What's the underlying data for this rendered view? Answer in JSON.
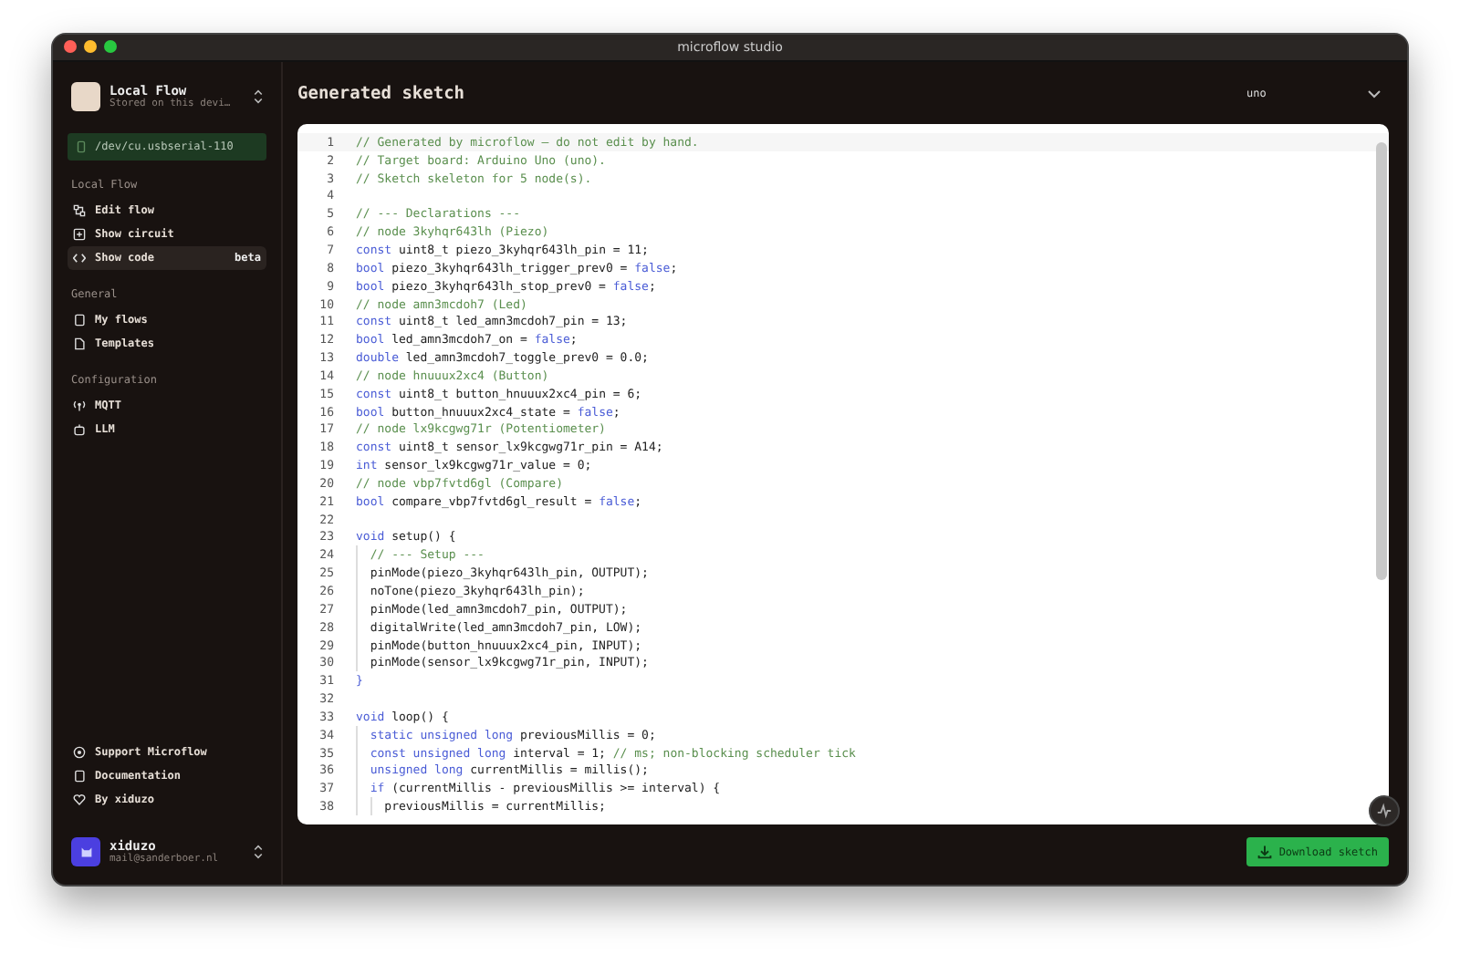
{
  "window": {
    "title": "microflow studio"
  },
  "project": {
    "name": "Local Flow",
    "subtitle": "Stored on this devi…"
  },
  "port": {
    "label": "/dev/cu.usbserial-110"
  },
  "sections": [
    {
      "title": "Local Flow",
      "items": [
        {
          "label": "Edit flow",
          "selected": false
        },
        {
          "label": "Show circuit",
          "selected": false
        },
        {
          "label": "Show code",
          "selected": true,
          "badge": "beta"
        }
      ]
    },
    {
      "title": "General",
      "items": [
        {
          "label": "My flows",
          "selected": false
        },
        {
          "label": "Templates",
          "selected": false
        }
      ]
    },
    {
      "title": "Configuration",
      "items": [
        {
          "label": "MQTT",
          "selected": false
        },
        {
          "label": "LLM",
          "selected": false
        }
      ]
    }
  ],
  "footer_links": [
    {
      "label": "Support Microflow"
    },
    {
      "label": "Documentation"
    },
    {
      "label": "By xiduzo"
    }
  ],
  "user": {
    "name": "xiduzo",
    "email": "mail@sanderboer.nl"
  },
  "header": {
    "title": "Generated sketch",
    "board": "uno"
  },
  "code": [
    {
      "n": "1",
      "tokens": [
        {
          "kind": "comment",
          "t": "// Generated by microflow — do not edit by hand."
        }
      ]
    },
    {
      "n": "2",
      "tokens": [
        {
          "kind": "comment",
          "t": "// Target board: Arduino Uno (uno)."
        }
      ]
    },
    {
      "n": "3",
      "tokens": [
        {
          "kind": "comment",
          "t": "// Sketch skeleton for 5 node(s)."
        }
      ]
    },
    {
      "n": "4"
    },
    {
      "n": "5",
      "tokens": [
        {
          "kind": "comment",
          "t": "// --- Declarations ---"
        }
      ]
    },
    {
      "n": "6",
      "tokens": [
        {
          "kind": "comment",
          "t": "// node 3kyhqr643lh (Piezo)"
        }
      ]
    },
    {
      "n": "7",
      "tokens": [
        {
          "kind": "keyword",
          "t": "const"
        },
        {
          "kind": "plain",
          "t": " uint8_t piezo_3kyhqr643lh_pin = 11;"
        }
      ]
    },
    {
      "n": "8",
      "tokens": [
        {
          "kind": "keyword",
          "t": "bool"
        },
        {
          "kind": "plain",
          "t": " piezo_3kyhqr643lh_trigger_prev0 = "
        },
        {
          "kind": "keyword",
          "t": "false"
        },
        {
          "kind": "plain",
          "t": ";"
        }
      ]
    },
    {
      "n": "9",
      "tokens": [
        {
          "kind": "keyword",
          "t": "bool"
        },
        {
          "kind": "plain",
          "t": " piezo_3kyhqr643lh_stop_prev0 = "
        },
        {
          "kind": "keyword",
          "t": "false"
        },
        {
          "kind": "plain",
          "t": ";"
        }
      ]
    },
    {
      "n": "10",
      "tokens": [
        {
          "kind": "comment",
          "t": "// node amn3mcdoh7 (Led)"
        }
      ]
    },
    {
      "n": "11",
      "tokens": [
        {
          "kind": "keyword",
          "t": "const"
        },
        {
          "kind": "plain",
          "t": " uint8_t led_amn3mcdoh7_pin = 13;"
        }
      ]
    },
    {
      "n": "12",
      "tokens": [
        {
          "kind": "keyword",
          "t": "bool"
        },
        {
          "kind": "plain",
          "t": " led_amn3mcdoh7_on = "
        },
        {
          "kind": "keyword",
          "t": "false"
        },
        {
          "kind": "plain",
          "t": ";"
        }
      ]
    },
    {
      "n": "13",
      "tokens": [
        {
          "kind": "keyword",
          "t": "double"
        },
        {
          "kind": "plain",
          "t": " led_amn3mcdoh7_toggle_prev0 = 0.0;"
        }
      ]
    },
    {
      "n": "14",
      "tokens": [
        {
          "kind": "comment",
          "t": "// node hnuuux2xc4 (Button)"
        }
      ]
    },
    {
      "n": "15",
      "tokens": [
        {
          "kind": "keyword",
          "t": "const"
        },
        {
          "kind": "plain",
          "t": " uint8_t button_hnuuux2xc4_pin = 6;"
        }
      ]
    },
    {
      "n": "16",
      "tokens": [
        {
          "kind": "keyword",
          "t": "bool"
        },
        {
          "kind": "plain",
          "t": " button_hnuuux2xc4_state = "
        },
        {
          "kind": "keyword",
          "t": "false"
        },
        {
          "kind": "plain",
          "t": ";"
        }
      ]
    },
    {
      "n": "17",
      "tokens": [
        {
          "kind": "comment",
          "t": "// node lx9kcgwg71r (Potentiometer)"
        }
      ]
    },
    {
      "n": "18",
      "tokens": [
        {
          "kind": "keyword",
          "t": "const"
        },
        {
          "kind": "plain",
          "t": " uint8_t sensor_lx9kcgwg71r_pin = A14;"
        }
      ]
    },
    {
      "n": "19",
      "tokens": [
        {
          "kind": "keyword",
          "t": "int"
        },
        {
          "kind": "plain",
          "t": " sensor_lx9kcgwg71r_value = 0;"
        }
      ]
    },
    {
      "n": "20",
      "tokens": [
        {
          "kind": "comment",
          "t": "// node vbp7fvtd6gl (Compare)"
        }
      ]
    },
    {
      "n": "21",
      "tokens": [
        {
          "kind": "keyword",
          "t": "bool"
        },
        {
          "kind": "plain",
          "t": " compare_vbp7fvtd6gl_result = "
        },
        {
          "kind": "keyword",
          "t": "false"
        },
        {
          "kind": "plain",
          "t": ";"
        }
      ]
    },
    {
      "n": "22"
    },
    {
      "n": "23",
      "tokens": [
        {
          "kind": "keyword",
          "t": "void"
        },
        {
          "kind": "plain",
          "t": " setup() {"
        }
      ]
    },
    {
      "n": "24",
      "tokens": [
        {
          "kind": "comment",
          "t": "  // --- Setup ---"
        }
      ]
    },
    {
      "n": "25",
      "tokens": [
        {
          "kind": "plain",
          "t": "  pinMode(piezo_3kyhqr643lh_pin, OUTPUT);"
        }
      ]
    },
    {
      "n": "26",
      "tokens": [
        {
          "kind": "plain",
          "t": "  noTone(piezo_3kyhqr643lh_pin);"
        }
      ]
    },
    {
      "n": "27",
      "tokens": [
        {
          "kind": "plain",
          "t": "  pinMode(led_amn3mcdoh7_pin, OUTPUT);"
        }
      ]
    },
    {
      "n": "28",
      "tokens": [
        {
          "kind": "plain",
          "t": "  digitalWrite(led_amn3mcdoh7_pin, LOW);"
        }
      ]
    },
    {
      "n": "29",
      "tokens": [
        {
          "kind": "plain",
          "t": "  pinMode(button_hnuuux2xc4_pin, INPUT);"
        }
      ]
    },
    {
      "n": "30",
      "tokens": [
        {
          "kind": "plain",
          "t": "  pinMode(sensor_lx9kcgwg71r_pin, INPUT);"
        }
      ]
    },
    {
      "n": "31",
      "tokens": [
        {
          "kind": "keyword",
          "t": "}"
        }
      ]
    },
    {
      "n": "32"
    },
    {
      "n": "33",
      "tokens": [
        {
          "kind": "keyword",
          "t": "void"
        },
        {
          "kind": "plain",
          "t": " loop() {"
        }
      ]
    },
    {
      "n": "34",
      "tokens": [
        {
          "kind": "keyword",
          "t": "  static unsigned long"
        },
        {
          "kind": "plain",
          "t": " previousMillis = 0;"
        }
      ]
    },
    {
      "n": "35",
      "tokens": [
        {
          "kind": "keyword",
          "t": "  const unsigned long"
        },
        {
          "kind": "plain",
          "t": " interval = 1; "
        },
        {
          "kind": "comment",
          "t": "// ms; non-blocking scheduler tick"
        }
      ]
    },
    {
      "n": "36",
      "tokens": [
        {
          "kind": "keyword",
          "t": "  unsigned long"
        },
        {
          "kind": "plain",
          "t": " currentMillis = millis();"
        }
      ]
    },
    {
      "n": "37",
      "tokens": [
        {
          "kind": "keyword",
          "t": "  if"
        },
        {
          "kind": "plain",
          "t": " (currentMillis - previousMillis >= interval) {"
        }
      ]
    },
    {
      "n": "38",
      "tokens": [
        {
          "kind": "plain",
          "t": "    previousMillis = currentMillis;"
        }
      ]
    }
  ],
  "download_button": {
    "label": "Download sketch"
  }
}
